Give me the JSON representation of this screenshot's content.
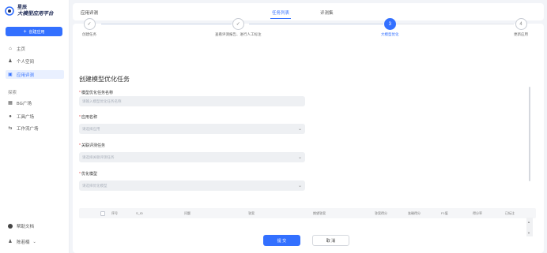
{
  "app": {
    "logo_line1": "星辰",
    "logo_line2": "大模型应用平台"
  },
  "sidebar": {
    "create_button": "创建应用",
    "items": [
      {
        "label": "主页",
        "icon": "home-icon"
      },
      {
        "label": "个人空间",
        "icon": "user-icon"
      },
      {
        "label": "应用评测",
        "icon": "evaluation-icon",
        "active": true
      }
    ],
    "section_label": "探索",
    "explore_items": [
      {
        "label": "BG广场",
        "icon": "grid-icon"
      },
      {
        "label": "工具广场",
        "icon": "tool-icon"
      },
      {
        "label": "工作流广场",
        "icon": "workflow-icon"
      }
    ],
    "help": "帮助文档",
    "username": "陈若楠"
  },
  "topbar": {
    "title": "应用评测",
    "tabs": [
      {
        "label": "任务列表",
        "active": true
      },
      {
        "label": "评测集",
        "active": false
      }
    ]
  },
  "steps": [
    {
      "index": "✓",
      "label": "创建任务",
      "state": "done"
    },
    {
      "index": "✓",
      "label": "查看评测报告、进行人工标注",
      "state": "done"
    },
    {
      "index": "3",
      "label": "大模型优化",
      "state": "current"
    },
    {
      "index": "4",
      "label": "更新应用",
      "state": "pending"
    }
  ],
  "form": {
    "title": "创建模型优化任务",
    "fields": [
      {
        "label": "模型优化任务名称",
        "required": true,
        "placeholder": "请输入模型优化任务名称",
        "type": "text"
      },
      {
        "label": "应用名称",
        "required": true,
        "placeholder": "请选择应用",
        "type": "select"
      },
      {
        "label": "关联评测任务",
        "required": true,
        "placeholder": "请选择关联评测任务",
        "type": "select"
      },
      {
        "label": "优化模型",
        "required": true,
        "placeholder": "请选择优化模型",
        "type": "select"
      }
    ]
  },
  "table": {
    "columns": [
      "序号",
      "S_ID",
      "问题",
      "答案",
      "期望答案",
      "答案得分",
      "准确得分",
      "F1值",
      "得分率",
      "已标注"
    ]
  },
  "actions": {
    "submit": "提 交",
    "cancel": "取 消"
  },
  "colors": {
    "accent": "#3370ff",
    "required": "#e5484d"
  }
}
